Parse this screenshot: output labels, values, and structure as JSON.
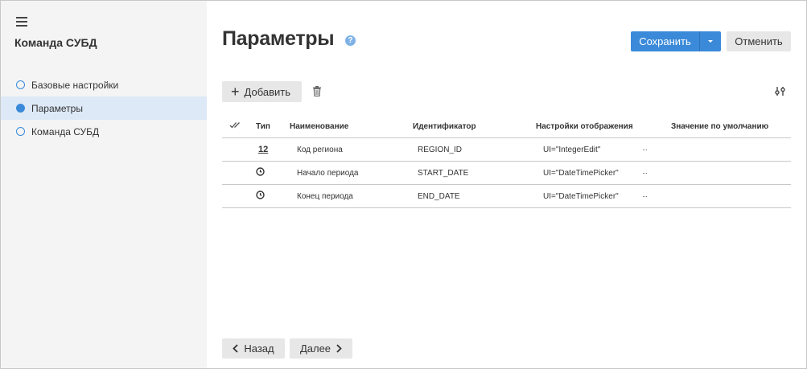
{
  "sidebar": {
    "title": "Команда СУБД",
    "steps": [
      {
        "label": "Базовые настройки",
        "active": false
      },
      {
        "label": "Параметры",
        "active": true
      },
      {
        "label": "Команда СУБД",
        "active": false
      }
    ]
  },
  "header": {
    "title": "Параметры",
    "help_glyph": "?",
    "save_label": "Сохранить",
    "cancel_label": "Отменить"
  },
  "toolbar": {
    "add_label": "Добавить"
  },
  "table": {
    "columns": {
      "type": "Тип",
      "name": "Наименование",
      "id": "Идентификатор",
      "display": "Настройки отображения",
      "default": "Значение по умолчанию"
    },
    "rows": [
      {
        "type": "12",
        "type_icon": "integer-icon",
        "name": "Код региона",
        "id": "REGION_ID",
        "display": "UI=\"IntegerEdit\"",
        "default": ""
      },
      {
        "type": "",
        "type_icon": "clock-icon",
        "name": "Начало периода",
        "id": "START_DATE",
        "display": "UI=\"DateTimePicker\"",
        "default": ""
      },
      {
        "type": "",
        "type_icon": "clock-icon",
        "name": "Конец периода",
        "id": "END_DATE",
        "display": "UI=\"DateTimePicker\"",
        "default": ""
      }
    ]
  },
  "footer": {
    "back_label": "Назад",
    "next_label": "Далее"
  },
  "colors": {
    "accent": "#3b8ad9",
    "sidebar_bg": "#f4f4f4",
    "active_step_bg": "#dde9f7"
  }
}
